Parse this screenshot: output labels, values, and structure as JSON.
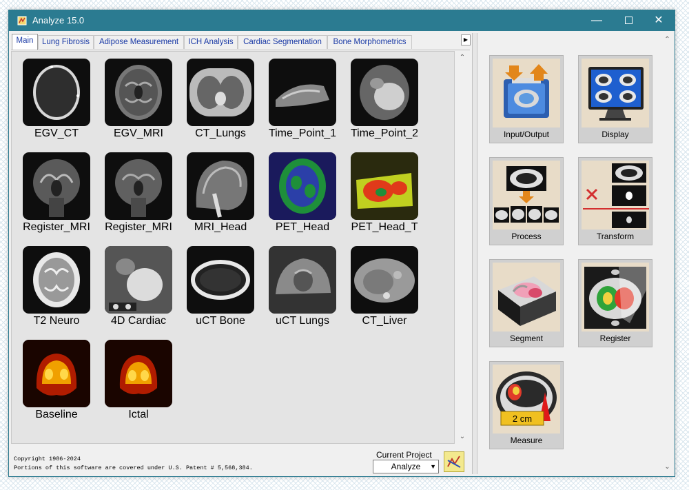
{
  "window": {
    "title": "Analyze 15.0"
  },
  "tabs": [
    {
      "label": "Main",
      "active": true
    },
    {
      "label": "Lung Fibrosis"
    },
    {
      "label": "Adipose Measurement"
    },
    {
      "label": "ICH Analysis"
    },
    {
      "label": "Cardiac Segmentation"
    },
    {
      "label": "Bone Morphometrics"
    }
  ],
  "thumbnails": [
    {
      "label": "EGV_CT",
      "icon": "ct-head-icon"
    },
    {
      "label": "EGV_MRI",
      "icon": "mri-brain-icon"
    },
    {
      "label": "CT_Lungs",
      "icon": "ct-lungs-icon"
    },
    {
      "label": "Time_Point_1",
      "icon": "timepoint-icon"
    },
    {
      "label": "Time_Point_2",
      "icon": "timepoint2-icon"
    },
    {
      "label": "Register_MRI",
      "icon": "mri-coronal-icon"
    },
    {
      "label": "Register_MRI",
      "icon": "mri-coronal2-icon"
    },
    {
      "label": "MRI_Head",
      "icon": "mri-sagittal-icon"
    },
    {
      "label": "PET_Head",
      "icon": "pet-head-icon"
    },
    {
      "label": "PET_Head_T",
      "icon": "pet-heatmap-icon"
    },
    {
      "label": "T2 Neuro",
      "icon": "t2-brain-icon"
    },
    {
      "label": "4D Cardiac",
      "icon": "cardiac-icon"
    },
    {
      "label": "uCT Bone",
      "icon": "bone-ring-icon"
    },
    {
      "label": "uCT Lungs",
      "icon": "uct-lungs-icon"
    },
    {
      "label": "CT_Liver",
      "icon": "ct-liver-icon"
    },
    {
      "label": "Baseline",
      "icon": "spect-baseline-icon"
    },
    {
      "label": "Ictal",
      "icon": "spect-ictal-icon"
    }
  ],
  "footer": {
    "copyright_line1": "Copyright 1986-2024",
    "copyright_line2": "Portions of this software are covered under U.S. Patent # 5,568,384.",
    "current_project_label": "Current Project",
    "current_project_value": "Analyze"
  },
  "tools": [
    {
      "label": "Input/Output",
      "icon": "input-output-icon"
    },
    {
      "label": "Display",
      "icon": "display-icon"
    },
    {
      "label": "Process",
      "icon": "process-icon"
    },
    {
      "label": "Transform",
      "icon": "transform-icon"
    },
    {
      "label": "Segment",
      "icon": "segment-icon"
    },
    {
      "label": "Register",
      "icon": "register-icon"
    },
    {
      "label": "Measure",
      "icon": "measure-icon",
      "caption": "2 cm"
    }
  ],
  "colors": {
    "titlebar": "#2b7b91",
    "tab_text": "#1a3aa6"
  }
}
